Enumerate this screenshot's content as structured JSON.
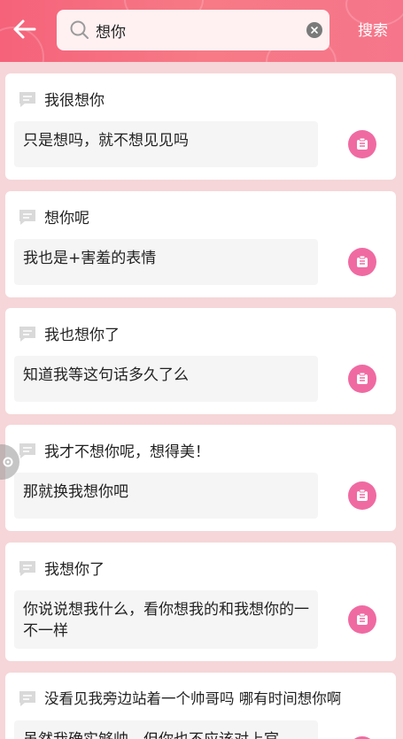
{
  "header": {
    "search": {
      "value": "想你",
      "placeholder": ""
    },
    "search_button_label": "搜索"
  },
  "results": [
    {
      "question": "我很想你",
      "answer": "只是想吗，就不想见见吗"
    },
    {
      "question": "想你呢",
      "answer": "我也是+害羞的表情"
    },
    {
      "question": "我也想你了",
      "answer": "知道我等这句话多久了么"
    },
    {
      "question": "我才不想你呢，想得美！",
      "answer": "那就换我想你吧"
    },
    {
      "question": "我想你了",
      "answer": "你说说想我什么，看你想我的和我想你的一不一样"
    },
    {
      "question": "没看见我旁边站着一个帅哥吗 哪有时间想你啊",
      "answer": "虽然我确实够帅，但你也不应该对上官"
    }
  ],
  "colors": {
    "header_start": "#f5627a",
    "header_end": "#f6758a",
    "page_bg": "#f6d6d8",
    "copy_button": "#f06aa2"
  },
  "icons": {
    "back": "arrow-left-icon",
    "search": "magnifier-icon",
    "clear": "close-circle-icon",
    "message": "chat-bubble-icon",
    "copy": "copy-icon"
  }
}
